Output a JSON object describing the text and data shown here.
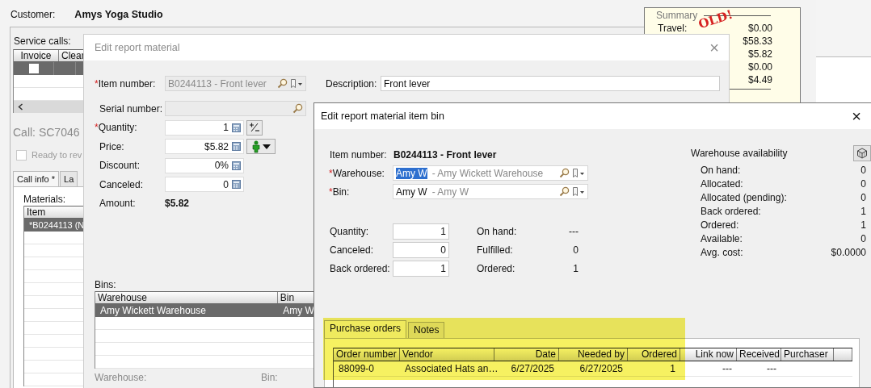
{
  "app": {
    "customer_label": "Customer:",
    "customer_name": "Amys Yoga Studio",
    "service_calls": {
      "label": "Service calls:",
      "columns": [
        "Invoice",
        "Clear"
      ],
      "rows": [
        {
          "invoice_checked": false,
          "selected": true
        }
      ]
    },
    "call_title": "Call: SC7046",
    "ready_checkbox": {
      "label": "Ready to rev",
      "checked": false
    },
    "tabs": [
      {
        "label": "Call info *",
        "selected": true
      },
      {
        "label": "La",
        "selected": false
      }
    ],
    "materials": {
      "label": "Materials:",
      "columns": [
        "Item"
      ],
      "rows": [
        {
          "item": "*B0244113 (N",
          "selected": true
        }
      ]
    },
    "summary": {
      "title": "Summary",
      "stamp": "OLD!",
      "rows": [
        {
          "label": "Travel:",
          "value": "$0.00"
        },
        {
          "value": "$58.33"
        },
        {
          "value": "$5.82"
        },
        {
          "value": "$0.00"
        },
        {
          "value": "$4.49"
        }
      ]
    }
  },
  "material_dialog": {
    "title": "Edit report material",
    "close": "×",
    "fields": [
      {
        "kind": "lookup",
        "required_mark": "*",
        "label": "Item number:",
        "value": "B0244113 - Front lever",
        "disabled": true
      },
      {
        "kind": "lookup",
        "label": "Serial number:",
        "disabled": true
      },
      {
        "kind": "number",
        "required_mark": "*",
        "label": "Quantity:",
        "value": "1",
        "adjust_button": true
      },
      {
        "kind": "number",
        "label": "Price:",
        "value": "$5.82",
        "price_button": true
      },
      {
        "kind": "number",
        "label": "Discount:",
        "value": "0%"
      },
      {
        "kind": "number",
        "label": "Canceled:",
        "value": "0"
      },
      {
        "kind": "total",
        "label": "Amount:",
        "value": "$5.82"
      }
    ],
    "description": {
      "label": "Description:",
      "value": "Front lever"
    },
    "bins": {
      "label": "Bins:",
      "columns": [
        "Warehouse",
        "Bin"
      ],
      "rows": [
        {
          "warehouse": "Amy Wickett Warehouse",
          "bin": "Amy W",
          "selected": true
        }
      ]
    },
    "bottom_labels": [
      "Warehouse:",
      "Bin:"
    ]
  },
  "bin_dialog": {
    "title": "Edit report material item bin",
    "close": "×",
    "item_number": {
      "label": "Item number:",
      "value": "B0244113 - Front lever"
    },
    "lookups": [
      {
        "required_mark": "*",
        "label": "Warehouse:",
        "code": "Amy W",
        "code_selected": true,
        "description": "- Amy Wickett Warehouse"
      },
      {
        "required_mark": "*",
        "label": "Bin:",
        "code": "Amy W",
        "code_selected": false,
        "description": "- Amy W"
      }
    ],
    "quantities": [
      {
        "label": "Quantity:",
        "value": "1"
      },
      {
        "label": "Canceled:",
        "value": "0"
      },
      {
        "label": "Back ordered:",
        "value": "1"
      }
    ],
    "stats": [
      {
        "label": "On hand:",
        "value": "---"
      },
      {
        "label": "Fulfilled:",
        "value": "0"
      },
      {
        "label": "Ordered:",
        "value": "1"
      }
    ],
    "availability": {
      "title": "Warehouse availability",
      "rows": [
        {
          "label": "On hand:",
          "value": "0"
        },
        {
          "label": "Allocated:",
          "value": "0"
        },
        {
          "label": "Allocated (pending):",
          "value": "0"
        },
        {
          "label": "Back ordered:",
          "value": "1"
        },
        {
          "label": "Ordered:",
          "value": "1"
        },
        {
          "label": "Available:",
          "value": "0"
        },
        {
          "label": "Avg. cost:",
          "value": "$0.0000"
        }
      ]
    },
    "tabs": [
      {
        "label": "Purchase orders",
        "selected": true
      },
      {
        "label": "Notes",
        "selected": false
      }
    ],
    "purchase_orders": {
      "columns": [
        "Order number",
        "Vendor",
        "Date",
        "Needed by",
        "Ordered",
        "Link now",
        "Received",
        "Purchaser"
      ],
      "rows": [
        {
          "cells": [
            "88099-0",
            "Associated Hats an…",
            "6/27/2025",
            "6/27/2025",
            "1",
            "---",
            "---"
          ]
        }
      ]
    },
    "annotation": {
      "kind": "highlight"
    }
  }
}
